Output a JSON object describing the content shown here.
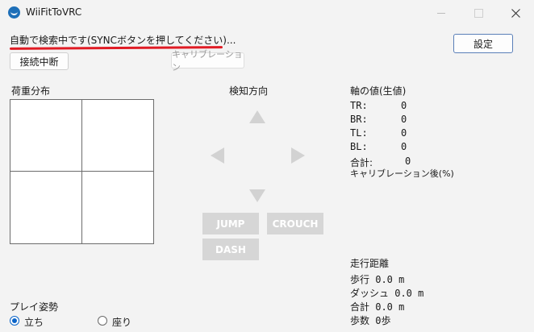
{
  "window": {
    "title": "WiiFitToVRC"
  },
  "status": {
    "text": "自動で検索中です(SYNCボタンを押してください)..."
  },
  "buttons": {
    "settings": "設定",
    "disconnect": "接続中断",
    "calibration": "キャリブレーション"
  },
  "load_distribution": {
    "label": "荷重分布"
  },
  "direction": {
    "label": "検知方向",
    "actions": {
      "jump": "JUMP",
      "crouch": "CROUCH",
      "dash": "DASH"
    }
  },
  "axis_values": {
    "title": "軸の値(生値)",
    "rows": [
      {
        "key": "TR:",
        "value": "0"
      },
      {
        "key": "BR:",
        "value": "0"
      },
      {
        "key": "TL:",
        "value": "0"
      },
      {
        "key": "BL:",
        "value": "0"
      }
    ],
    "total_label": "合計:",
    "total_value": "0",
    "post_calibration": "キャリブレーション後(%)"
  },
  "distance": {
    "title": "走行距離",
    "walk": "歩行 0.0 m",
    "dash": "ダッシュ 0.0 m",
    "total": "合計 0.0 m",
    "steps": "歩数 0歩"
  },
  "posture": {
    "label": "プレイ姿勢",
    "options": {
      "standing": "立ち",
      "sitting": "座り"
    },
    "selected": "standing"
  },
  "colors": {
    "accent": "#0a64c8",
    "underline": "#e01b24",
    "disabled": "#d6d6d6"
  }
}
